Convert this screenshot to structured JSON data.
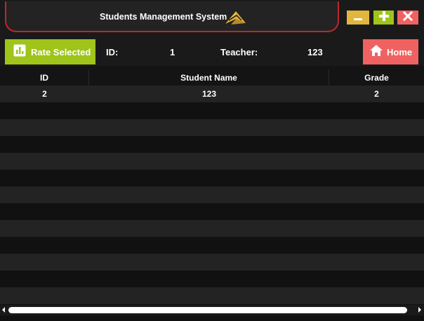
{
  "window": {
    "title": "Students Management System",
    "logo_icon": "paper-plane-logo-icon",
    "controls": {
      "minimize_icon": "minus-icon",
      "maximize_icon": "plus-icon",
      "close_icon": "close-icon"
    }
  },
  "toolbar": {
    "rate_label": "Rate Selected",
    "rate_icon": "bar-chart-icon",
    "id_label": "ID:",
    "id_value": "1",
    "teacher_label": "Teacher:",
    "teacher_value": "123",
    "home_label": "Home",
    "home_icon": "home-icon"
  },
  "table": {
    "columns": [
      "ID",
      "Student Name",
      "Grade"
    ],
    "rows": [
      [
        "2",
        "123",
        "2"
      ],
      [
        "",
        "",
        ""
      ],
      [
        "",
        "",
        ""
      ],
      [
        "",
        "",
        ""
      ],
      [
        "",
        "",
        ""
      ],
      [
        "",
        "",
        ""
      ],
      [
        "",
        "",
        ""
      ],
      [
        "",
        "",
        ""
      ],
      [
        "",
        "",
        ""
      ],
      [
        "",
        "",
        ""
      ],
      [
        "",
        "",
        ""
      ],
      [
        "",
        "",
        ""
      ],
      [
        "",
        "",
        ""
      ],
      [
        "",
        "",
        ""
      ]
    ]
  },
  "colors": {
    "accent_yellow": "#e2b53f",
    "accent_green": "#9fc41a",
    "accent_red": "#f06261",
    "title_border": "#c0262d",
    "background": "#141414"
  }
}
